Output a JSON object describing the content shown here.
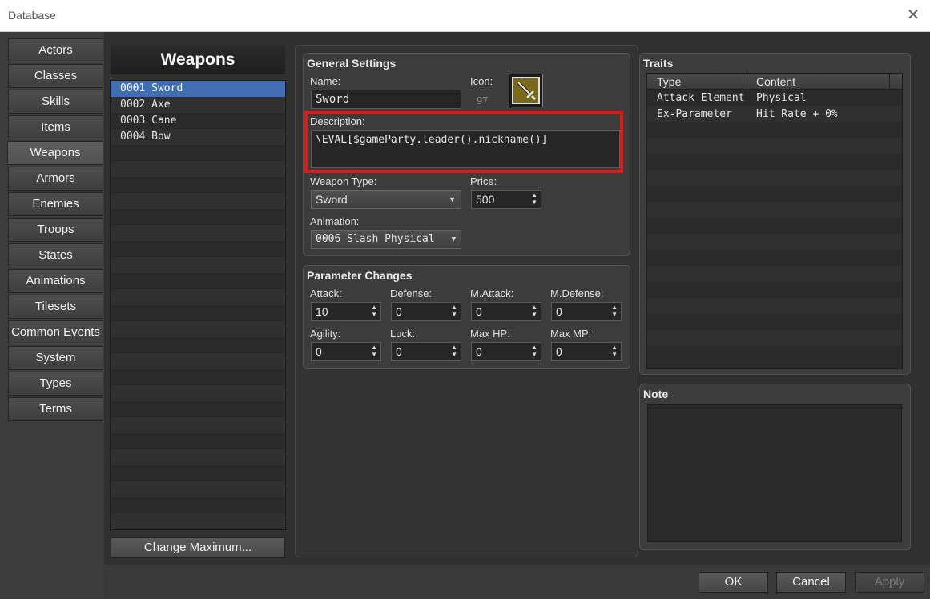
{
  "window": {
    "title": "Database"
  },
  "nav": {
    "items": [
      "Actors",
      "Classes",
      "Skills",
      "Items",
      "Weapons",
      "Armors",
      "Enemies",
      "Troops",
      "States",
      "Animations",
      "Tilesets",
      "Common Events",
      "System",
      "Types",
      "Terms"
    ],
    "active": "Weapons"
  },
  "list": {
    "header": "Weapons",
    "items": [
      "0001 Sword",
      "0002 Axe",
      "0003 Cane",
      "0004 Bow"
    ],
    "selected": "0001 Sword",
    "change_max_label": "Change Maximum..."
  },
  "general": {
    "title": "General Settings",
    "name_label": "Name:",
    "name_value": "Sword",
    "icon_label": "Icon:",
    "icon_index": "97",
    "icon_name": "sword-icon",
    "description_label": "Description:",
    "description_value": "\\EVAL[$gameParty.leader().nickname()]",
    "weapon_type_label": "Weapon Type:",
    "weapon_type_value": "Sword",
    "price_label": "Price:",
    "price_value": "500",
    "animation_label": "Animation:",
    "animation_value": "0006 Slash Physical"
  },
  "params": {
    "title": "Parameter Changes",
    "attack_label": "Attack:",
    "attack": "10",
    "defense_label": "Defense:",
    "defense": "0",
    "mattack_label": "M.Attack:",
    "mattack": "0",
    "mdefense_label": "M.Defense:",
    "mdefense": "0",
    "agility_label": "Agility:",
    "agility": "0",
    "luck_label": "Luck:",
    "luck": "0",
    "maxhp_label": "Max HP:",
    "maxhp": "0",
    "maxmp_label": "Max MP:",
    "maxmp": "0"
  },
  "traits": {
    "title": "Traits",
    "columns": [
      "Type",
      "Content"
    ],
    "rows": [
      {
        "type": "Attack Element",
        "content": "Physical"
      },
      {
        "type": "Ex-Parameter",
        "content": "Hit Rate + 0%"
      }
    ]
  },
  "note": {
    "title": "Note"
  },
  "footer": {
    "ok": "OK",
    "cancel": "Cancel",
    "apply": "Apply"
  },
  "colors": {
    "highlight": "#e01818",
    "selection": "#3f6eb2"
  }
}
